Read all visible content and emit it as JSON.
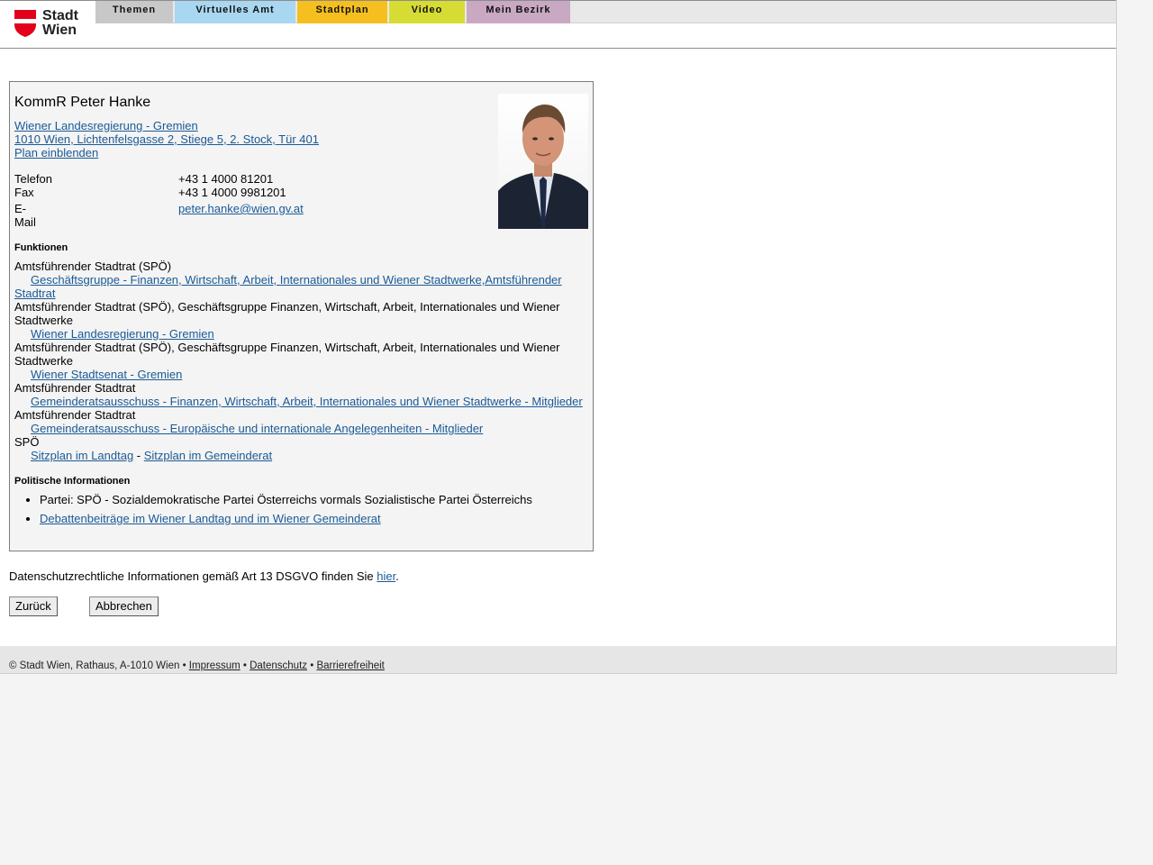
{
  "header": {
    "logo_line1": "Stadt",
    "logo_line2": "Wien",
    "brand_color": "#e2001a",
    "nav": [
      {
        "label": "Themen",
        "color": "#c8c8c8"
      },
      {
        "label": "Virtuelles Amt",
        "color": "#a9d6f0"
      },
      {
        "label": "Stadtplan",
        "color": "#f5c01f"
      },
      {
        "label": "Video",
        "color": "#d7dc35"
      },
      {
        "label": "Mein Bezirk",
        "color": "#c9a8c3"
      }
    ]
  },
  "person": {
    "name": "KommR Peter Hanke",
    "org_link": "Wiener Landesregierung - Gremien ",
    "address_link": "1010 Wien, Lichtenfelsgasse 2, Stiege 5, 2. Stock, Tür 401",
    "plan_link": "Plan einblenden",
    "contact": [
      {
        "label": "Telefon",
        "value": "+43 1 4000 81201"
      },
      {
        "label": "Fax",
        "value": "+43 1 4000 9981201"
      },
      {
        "label": "E-Mail",
        "value": "peter.hanke@wien.gv.at"
      }
    ]
  },
  "functions": {
    "heading": "Funktionen",
    "entries": [
      {
        "title": "Amtsführender Stadtrat (SPÖ)",
        "link": "Geschäftsgruppe - Finanzen, Wirtschaft, Arbeit, Internationales und Wiener Stadtwerke,Amtsführender Stadtrat"
      },
      {
        "title": "Amtsführender Stadtrat (SPÖ), Geschäftsgruppe Finanzen, Wirtschaft, Arbeit, Internationales und Wiener Stadtwerke",
        "link": "Wiener Landesregierung - Gremien"
      },
      {
        "title": "Amtsführender Stadtrat (SPÖ), Geschäftsgruppe Finanzen, Wirtschaft, Arbeit, Internationales und Wiener Stadtwerke",
        "link": "Wiener Stadtsenat - Gremien"
      },
      {
        "title": "Amtsführender Stadtrat",
        "link": "Gemeinderatsausschuss - Finanzen, Wirtschaft, Arbeit, Internationales und Wiener Stadtwerke - Mitglieder"
      },
      {
        "title": "Amtsführender Stadtrat",
        "link": "Gemeinderatsausschuss - Europäische und internationale Angelegenheiten - Mitglieder"
      }
    ],
    "last_title": "SPÖ",
    "seat_landtag": "Sitzplan im Landtag",
    "seat_separator": " - ",
    "seat_gemeinderat": "Sitzplan im Gemeinderat"
  },
  "political": {
    "heading": "Politische Informationen",
    "party": "Partei: SPÖ - Sozialdemokratische Partei Österreichs vormals Sozialistische Partei Österreichs",
    "debates_link": "Debattenbeiträge im Wiener Landtag und im Wiener Gemeinderat"
  },
  "dsgvo": {
    "text": "Datenschutzrechtliche Informationen gemäß Art 13 DSGVO finden Sie ",
    "link": "hier",
    "suffix": "."
  },
  "buttons": {
    "back": "Zurück",
    "cancel": "Abbrechen"
  },
  "footer": {
    "copyright": "© Stadt Wien, Rathaus, A-1010 Wien • ",
    "impressum": "Impressum",
    "sep": " • ",
    "datenschutz": "Datenschutz",
    "barrierefreiheit": "Barrierefreiheit"
  }
}
